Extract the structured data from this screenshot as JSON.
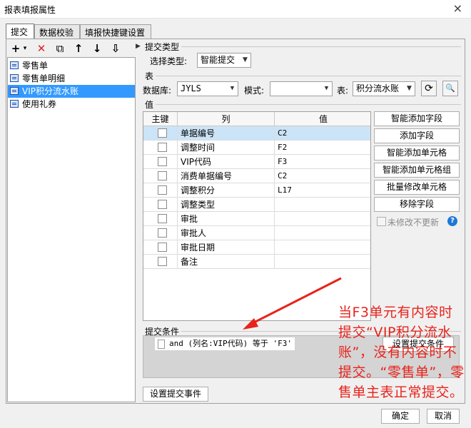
{
  "window": {
    "title": "报表填报属性",
    "close_label": "×"
  },
  "tabs": [
    {
      "label": "提交",
      "active": true
    },
    {
      "label": "数据校验",
      "active": false
    },
    {
      "label": "填报快捷键设置",
      "active": false
    }
  ],
  "toolbar": {
    "add": "+",
    "add_dropdown": "▾",
    "delete": "✕",
    "copy": "⧉",
    "up": "↑",
    "down": "↓",
    "sort": "⇩"
  },
  "tree": {
    "items": [
      {
        "label": "零售单",
        "selected": false
      },
      {
        "label": "零售单明细",
        "selected": false
      },
      {
        "label": "VIP积分流水账",
        "selected": true
      },
      {
        "label": "使用礼券",
        "selected": false
      }
    ]
  },
  "submit_type": {
    "group_label": "提交类型",
    "select_label": "选择类型:",
    "value": "智能提交"
  },
  "table_group": {
    "group_label": "表",
    "database_label": "数据库:",
    "database_value": "JYLS",
    "mode_label": "模式:",
    "mode_value": "",
    "table_label": "表:",
    "table_value": "积分流水账",
    "refresh_icon": "⟳",
    "preview_icon": "🔍"
  },
  "value_group": {
    "group_label": "值",
    "headers": {
      "key": "主键",
      "column": "列",
      "value": "值"
    },
    "rows": [
      {
        "column": "单据编号",
        "value": "C2",
        "checked": false,
        "selected": true
      },
      {
        "column": "调整时间",
        "value": "F2",
        "checked": false,
        "selected": false
      },
      {
        "column": "VIP代码",
        "value": "F3",
        "checked": false,
        "selected": false
      },
      {
        "column": "消费单据编号",
        "value": "C2",
        "checked": false,
        "selected": false
      },
      {
        "column": "调整积分",
        "value": "L17",
        "checked": false,
        "selected": false
      },
      {
        "column": "调整类型",
        "value": "",
        "checked": false,
        "selected": false
      },
      {
        "column": "审批",
        "value": "",
        "checked": false,
        "selected": false
      },
      {
        "column": "审批人",
        "value": "",
        "checked": false,
        "selected": false
      },
      {
        "column": "审批日期",
        "value": "",
        "checked": false,
        "selected": false
      },
      {
        "column": "备注",
        "value": "",
        "checked": false,
        "selected": false
      }
    ]
  },
  "side_buttons": {
    "smart_add_field": "智能添加字段",
    "add_field": "添加字段",
    "smart_add_cell": "智能添加单元格",
    "smart_add_cell_group": "智能添加单元格组",
    "batch_modify_cell": "批量修改单元格",
    "remove_field": "移除字段",
    "no_update_unmodified": "未修改不更新",
    "help": "?"
  },
  "condition": {
    "group_label": "提交条件",
    "item": "and (列名:VIP代码) 等于 'F3'",
    "set_condition_button": "设置提交条件"
  },
  "bottom": {
    "set_event_button": "设置提交事件",
    "ok_button": "确定",
    "cancel_button": "取消"
  },
  "annotation": {
    "text": "当F3单元有内容时提交“VIP积分流水账”，没有内容时不提交。“零售单”，零售单主表正常提交。",
    "color": "#e8231b"
  },
  "colors": {
    "selection": "#3399ff",
    "row_selection": "#cce4f7",
    "help_blue": "#1e78d7"
  }
}
